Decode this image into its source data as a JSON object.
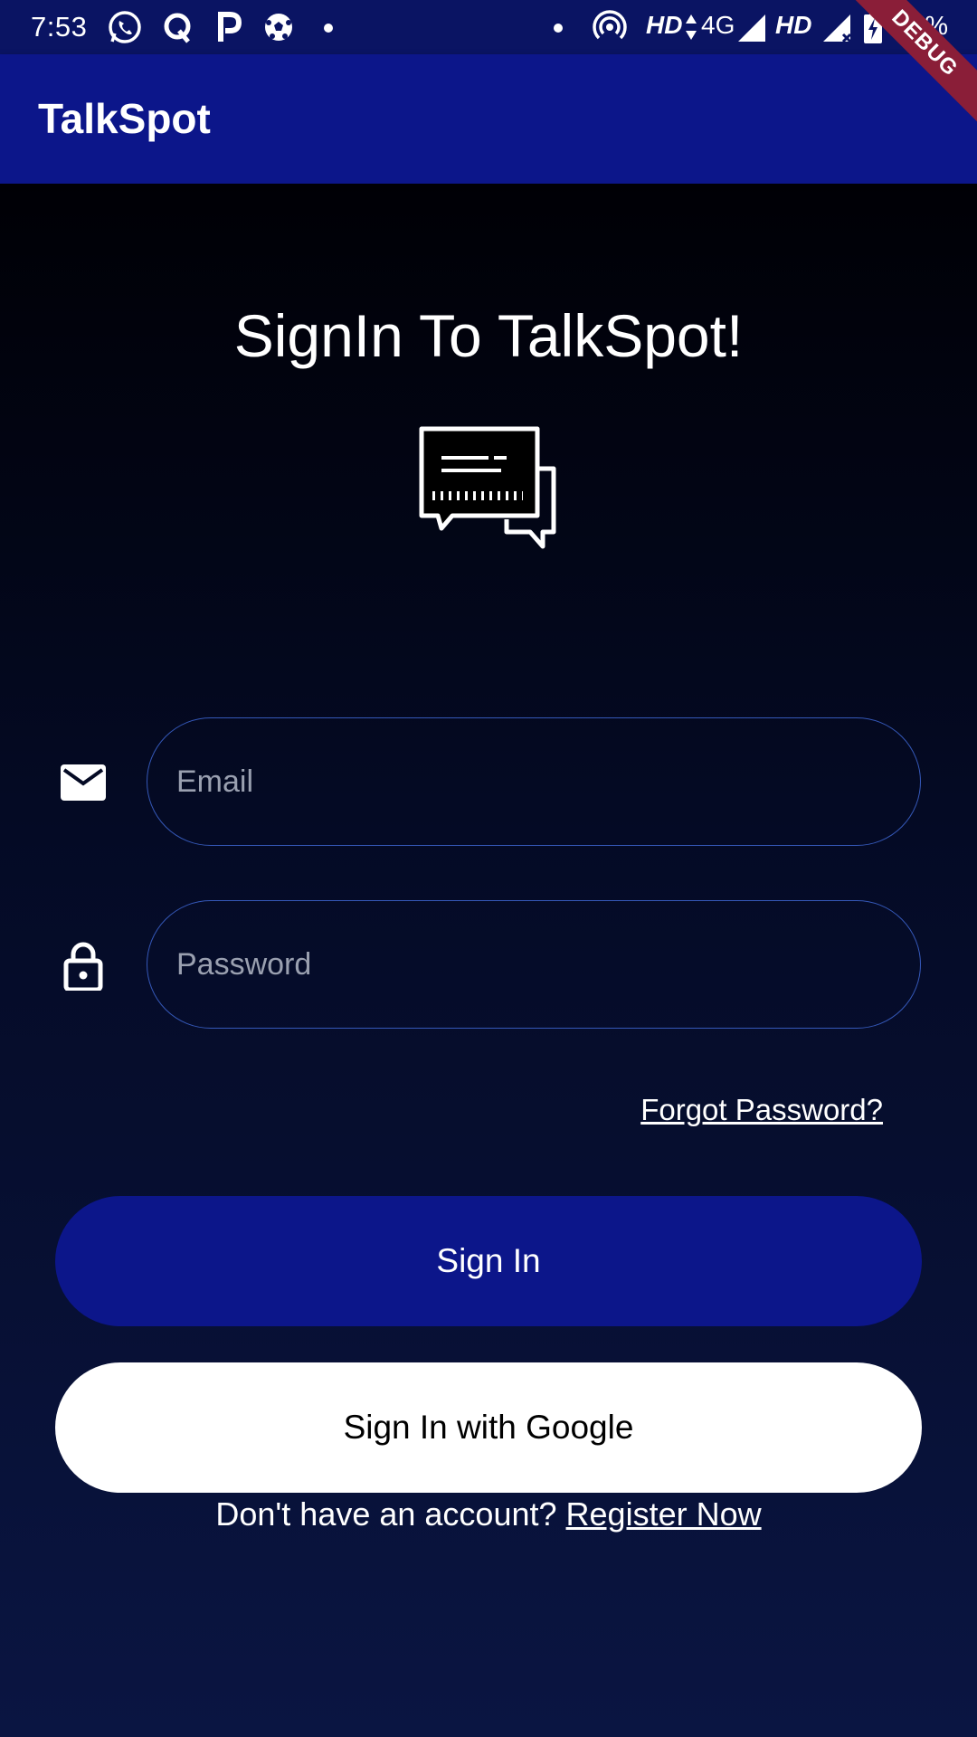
{
  "status_bar": {
    "time": "7:53",
    "network_hd_1": "HD",
    "network_type": "4G",
    "network_hd_2": "HD",
    "battery": "38%",
    "icons": [
      "whatsapp-icon",
      "q-icon",
      "paytm-icon",
      "soccer-icon",
      "dot-icon",
      "dot-icon",
      "hotspot-icon",
      "signal-icon",
      "signal-icon",
      "battery-charging-icon"
    ]
  },
  "debug_banner": "DEBUG",
  "app_bar": {
    "title": "TalkSpot"
  },
  "signin": {
    "heading": "SignIn To TalkSpot!",
    "logo_icon": "chat-bubbles-icon",
    "email": {
      "placeholder": "Email",
      "value": "",
      "icon": "mail-icon"
    },
    "password": {
      "placeholder": "Password",
      "value": "",
      "icon": "lock-icon"
    },
    "forgot_label": "Forgot Password?",
    "signin_label": "Sign In",
    "google_label": "Sign In with Google",
    "register_prompt": "Don't have an account?",
    "register_link": "Register Now"
  },
  "colors": {
    "app_bar": "#0c168a",
    "status_bar": "#0a1463",
    "input_border": "#3558b8",
    "debug_banner": "#8a1e38"
  }
}
